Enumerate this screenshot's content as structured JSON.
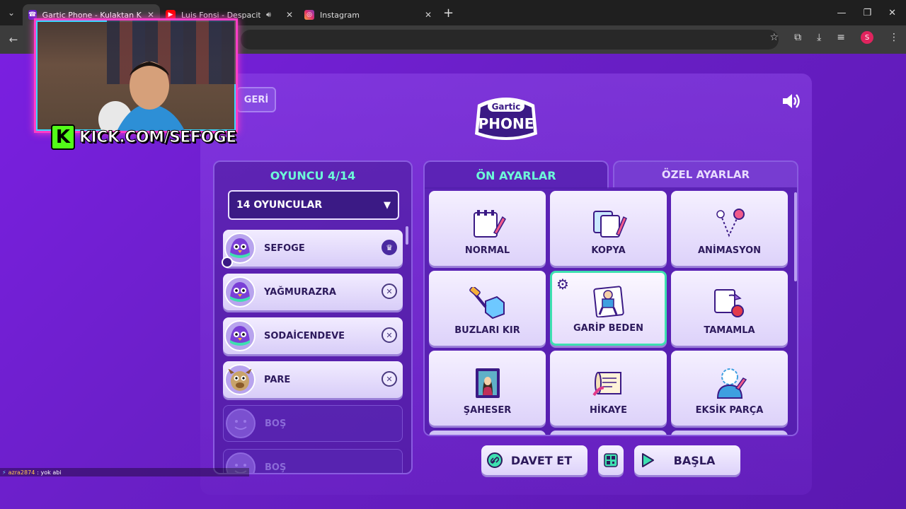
{
  "browser": {
    "tabs": [
      {
        "title": "Gartic Phone - Kulaktan Kulağa",
        "active": true,
        "icon": "phone-icon",
        "color": "#6a1fc7"
      },
      {
        "title": "Luis Fonsi - Despacito ft. Da",
        "active": false,
        "icon": "youtube-icon",
        "color": "#ff0000"
      },
      {
        "title": "Instagram",
        "active": false,
        "icon": "instagram-icon",
        "color": "#e1306c"
      }
    ],
    "profile_initial": "S"
  },
  "stream": {
    "kick_letter": "K",
    "kick_url": "KICK.COM/SEFOGE",
    "chat_user": "azra2874",
    "chat_message": ": yok abi"
  },
  "game": {
    "back_label": "GERİ",
    "logo_top": "Gartic",
    "logo_bottom": "PHONE",
    "players_title": "OYUNCU 4/14",
    "player_count_select": "14 OYUNCULAR",
    "players": [
      {
        "name": "SEFOGE",
        "action": "crown",
        "avatar": "#8a4fe0",
        "host": true
      },
      {
        "name": "YAĞMURAZRA",
        "action": "kick",
        "avatar": "#8a4fe0",
        "host": false
      },
      {
        "name": "SODAİCENDEVE",
        "action": "kick",
        "avatar": "#8a4fe0",
        "host": false
      },
      {
        "name": "PARE",
        "action": "kick",
        "avatar": "#c9a36a",
        "host": false
      },
      {
        "name": "BOŞ",
        "empty": true
      },
      {
        "name": "BOŞ",
        "empty": true
      }
    ],
    "tab_presets": "ÖN AYARLAR",
    "tab_custom": "ÖZEL AYARLAR",
    "presets": [
      {
        "label": "NORMAL",
        "icon": "notepad-icon",
        "selected": false
      },
      {
        "label": "KOPYA",
        "icon": "copy-cards-icon",
        "selected": false
      },
      {
        "label": "ANİMASYON",
        "icon": "animation-icon",
        "selected": false
      },
      {
        "label": "BUZLARI KIR",
        "icon": "ice-hammer-icon",
        "selected": false
      },
      {
        "label": "GARİP BEDEN",
        "icon": "weird-body-icon",
        "selected": true
      },
      {
        "label": "TAMAMLA",
        "icon": "puzzle-icon",
        "selected": false
      },
      {
        "label": "ŞAHESER",
        "icon": "masterpiece-icon",
        "selected": false
      },
      {
        "label": "HİKAYE",
        "icon": "story-scroll-icon",
        "selected": false
      },
      {
        "label": "EKSİK PARÇA",
        "icon": "missing-piece-icon",
        "selected": false
      }
    ],
    "invite_label": "DAVET ET",
    "start_label": "BAŞLA",
    "accent": "#6dfbd8"
  }
}
